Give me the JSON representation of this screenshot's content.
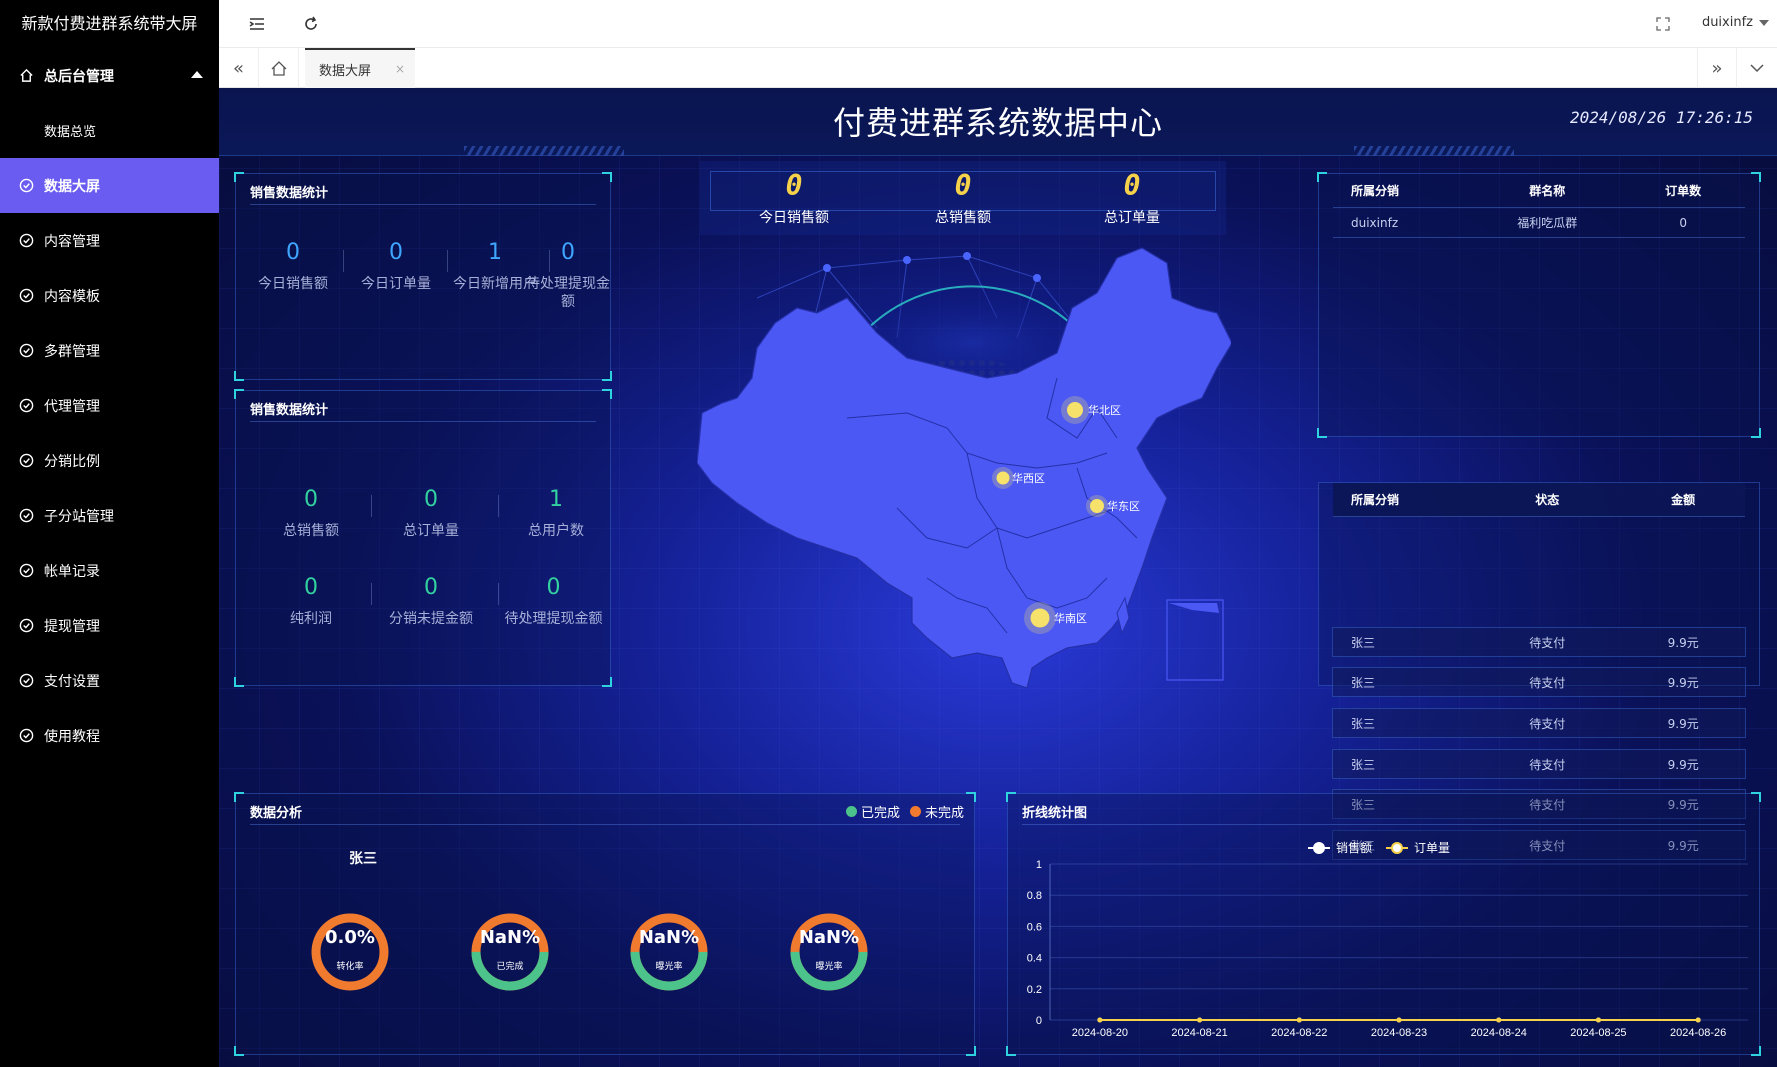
{
  "app": {
    "title": "新款付费进群系统带大屏"
  },
  "sidebar": {
    "items": [
      {
        "label": "总后台管理"
      },
      {
        "label": "数据总览"
      },
      {
        "label": "数据大屏"
      },
      {
        "label": "内容管理"
      },
      {
        "label": "内容模板"
      },
      {
        "label": "多群管理"
      },
      {
        "label": "代理管理"
      },
      {
        "label": "分销比例"
      },
      {
        "label": "子分站管理"
      },
      {
        "label": "帐单记录"
      },
      {
        "label": "提现管理"
      },
      {
        "label": "支付设置"
      },
      {
        "label": "使用教程"
      }
    ]
  },
  "topbar": {
    "user": "duixinfz"
  },
  "tabs": {
    "active": "数据大屏",
    "close": "×"
  },
  "dashboard": {
    "title": "付费进群系统数据中心",
    "datetime": "2024/08/26 17:26:15",
    "sales_panel": {
      "title": "销售数据统计",
      "stats": [
        {
          "value": "0",
          "label": "今日销售额"
        },
        {
          "value": "0",
          "label": "今日订单量"
        },
        {
          "value": "1",
          "label": "今日新增用户"
        },
        {
          "value": "0",
          "label": "待处理提现金额"
        }
      ]
    },
    "sales_panel2": {
      "title": "销售数据统计",
      "stats": [
        {
          "value": "0",
          "label": "总销售额"
        },
        {
          "value": "0",
          "label": "总订单量"
        },
        {
          "value": "1",
          "label": "总用户数"
        },
        {
          "value": "0",
          "label": "纯利润"
        },
        {
          "value": "0",
          "label": "分销未提金额"
        },
        {
          "value": "0",
          "label": "待处理提现金额"
        }
      ]
    },
    "counters": [
      {
        "value": "0",
        "label": "今日销售额"
      },
      {
        "value": "0",
        "label": "总销售额"
      },
      {
        "value": "0",
        "label": "总订单量"
      }
    ],
    "map": {
      "regions": [
        {
          "name": "华北区"
        },
        {
          "name": "华西区"
        },
        {
          "name": "华东区"
        },
        {
          "name": "华南区"
        }
      ]
    },
    "group_table": {
      "headers": [
        "所属分销",
        "群名称",
        "订单数"
      ],
      "rows": [
        [
          "duixinfz",
          "福利吃瓜群",
          "0"
        ]
      ]
    },
    "order_table": {
      "headers": [
        "所属分销",
        "状态",
        "金额"
      ],
      "rows": [
        [
          "张三",
          "待支付",
          "9.9元"
        ],
        [
          "张三",
          "待支付",
          "9.9元"
        ],
        [
          "张三",
          "待支付",
          "9.9元"
        ],
        [
          "张三",
          "待支付",
          "9.9元"
        ],
        [
          "张三",
          "待支付",
          "9.9元"
        ],
        [
          "张三",
          "待支付",
          "9.9元"
        ]
      ]
    },
    "analysis": {
      "title": "数据分析",
      "name": "张三",
      "legend": [
        {
          "label": "已完成",
          "color": "#4cc38a"
        },
        {
          "label": "未完成",
          "color": "#f07a2e"
        }
      ],
      "rings": [
        {
          "value": "0.0%",
          "label": "转化率",
          "completed_fraction": 0
        },
        {
          "value": "NaN%",
          "label": "已完成",
          "completed_fraction": 0.5
        },
        {
          "value": "NaN%",
          "label": "曝光率",
          "completed_fraction": 0.5
        },
        {
          "value": "NaN%",
          "label": "曝光率",
          "completed_fraction": 0.5
        }
      ]
    },
    "line_chart": {
      "title": "折线统计图"
    }
  },
  "chart_data": {
    "type": "line",
    "x": [
      "2024-08-20",
      "2024-08-21",
      "2024-08-22",
      "2024-08-23",
      "2024-08-24",
      "2024-08-25",
      "2024-08-26"
    ],
    "series": [
      {
        "name": "销售额",
        "values": [
          0,
          0,
          0,
          0,
          0,
          0,
          0
        ],
        "color": "#ffffff"
      },
      {
        "name": "订单量",
        "values": [
          0,
          0,
          0,
          0,
          0,
          0,
          0
        ],
        "color": "#f6d24a"
      }
    ],
    "yticks": [
      "0",
      "0.2",
      "0.4",
      "0.6",
      "0.8",
      "1"
    ],
    "ylim": [
      0,
      1
    ],
    "grid": true,
    "legend": "top-center"
  }
}
